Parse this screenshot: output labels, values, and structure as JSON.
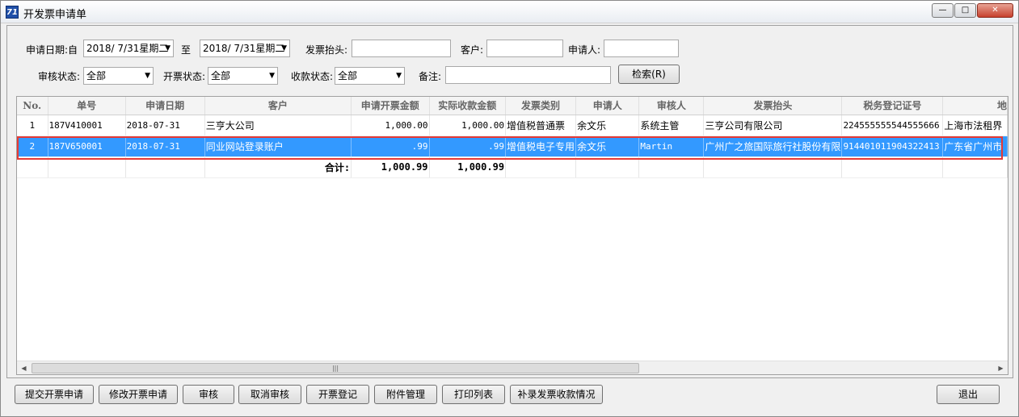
{
  "window": {
    "title": "开发票申请单",
    "app_icon_text": "71",
    "min_glyph": "—",
    "max_glyph": "□",
    "close_glyph": "✕"
  },
  "filters": {
    "date_label": "申请日期:自",
    "date_from": "2018/ 7/31星期二",
    "to_label": "至",
    "date_to": "2018/ 7/31星期二",
    "invoice_title_label": "发票抬头:",
    "invoice_title_value": "",
    "customer_label": "客户:",
    "customer_value": "",
    "applicant_label": "申请人:",
    "applicant_value": "",
    "audit_status_label": "审核状态:",
    "audit_status_value": "全部",
    "invoice_status_label": "开票状态:",
    "invoice_status_value": "全部",
    "payment_status_label": "收款状态:",
    "payment_status_value": "全部",
    "remark_label": "备注:",
    "remark_value": "",
    "search_button": "检索(R)"
  },
  "table": {
    "columns": [
      "No.",
      "单号",
      "申请日期",
      "客户",
      "申请开票金额",
      "实际收款金额",
      "发票类别",
      "申请人",
      "审核人",
      "发票抬头",
      "税务登记证号",
      "地"
    ],
    "rows": [
      {
        "no": "1",
        "order_no": "187V410001",
        "date": "2018-07-31",
        "customer": "三亨大公司",
        "apply_amount": "1,000.00",
        "actual_amount": "1,000.00",
        "invoice_type": "增值税普通票",
        "applicant": "余文乐",
        "auditor": "系统主管",
        "invoice_title": "三亨公司有限公司",
        "tax_id": "224555555544555666",
        "address": "上海市法租界"
      },
      {
        "no": "2",
        "order_no": "187V650001",
        "date": "2018-07-31",
        "customer": "同业网站登录账户",
        "apply_amount": ".99",
        "actual_amount": ".99",
        "invoice_type": "增值税电子专用",
        "applicant": "余文乐",
        "auditor": "Martin",
        "invoice_title": "广州广之旅国际旅行社股份有限",
        "tax_id": "914401011904322413",
        "address": "广东省广州市"
      }
    ],
    "total_label": "合计:",
    "total_apply_amount": "1,000.99",
    "total_actual_amount": "1,000.99",
    "selected_row_color": "#3399ff",
    "highlight_frame_color": "#e53935"
  },
  "buttons": {
    "submit": "提交开票申请",
    "modify": "修改开票申请",
    "audit": "审核",
    "cancel_audit": "取消审核",
    "register": "开票登记",
    "attachments": "附件管理",
    "print": "打印列表",
    "supplement": "补录发票收款情况",
    "exit": "退出"
  },
  "scrollbar": {
    "left_arrow": "◀",
    "right_arrow": "▶",
    "thumb_grip": "|||"
  }
}
